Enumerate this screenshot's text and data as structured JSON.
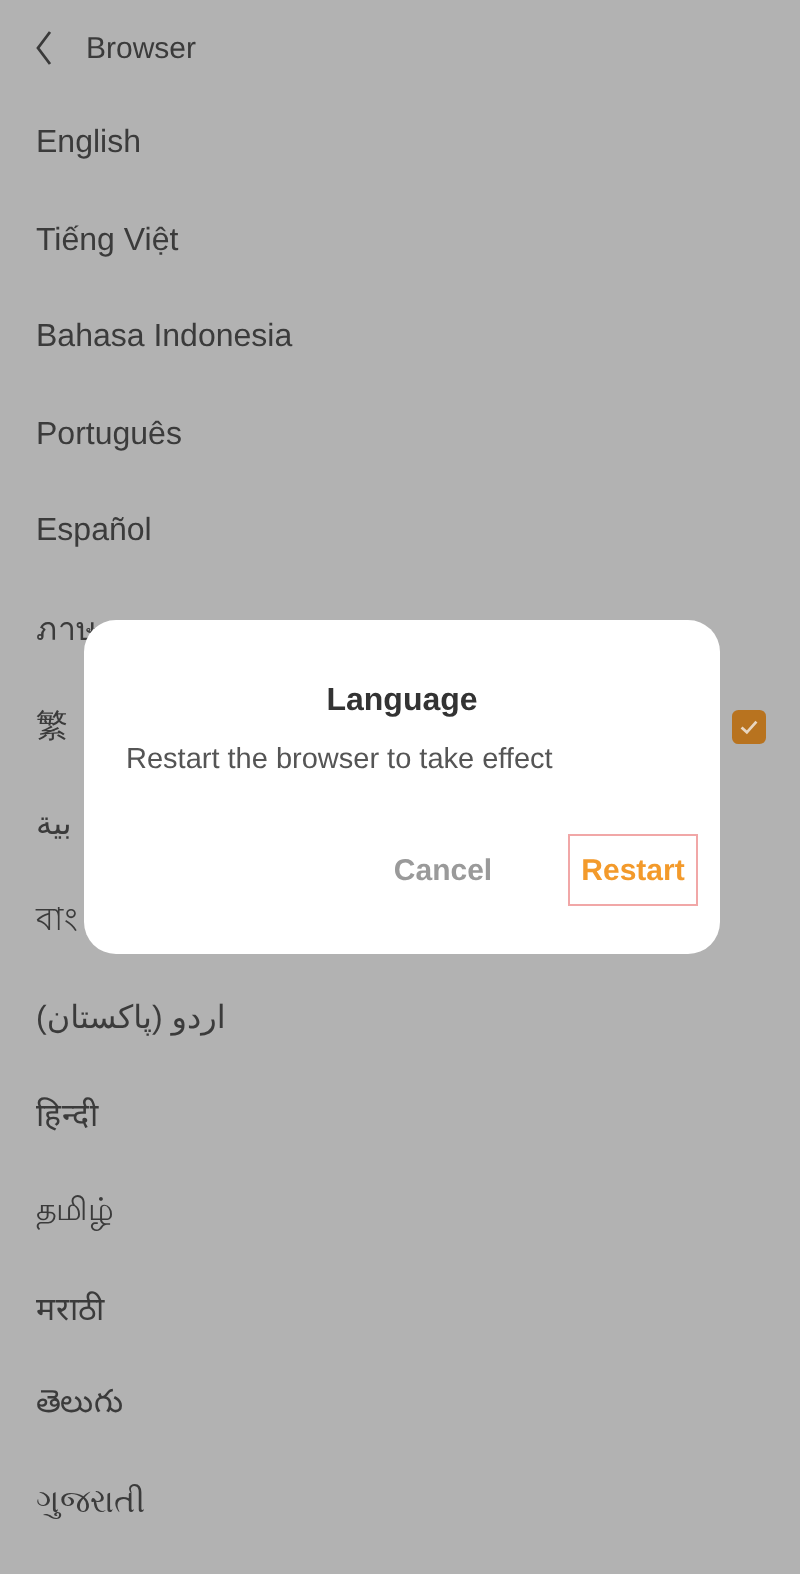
{
  "header": {
    "title": "Browser"
  },
  "languages": [
    {
      "label": "English",
      "selected": false
    },
    {
      "label": "Tiếng Việt",
      "selected": false
    },
    {
      "label": "Bahasa Indonesia",
      "selected": false
    },
    {
      "label": "Português",
      "selected": false
    },
    {
      "label": "Español",
      "selected": false
    },
    {
      "label": "ภาษ",
      "selected": false
    },
    {
      "label": "繁",
      "selected": true
    },
    {
      "label": "بية",
      "selected": false
    },
    {
      "label": "বাং",
      "selected": false
    },
    {
      "label": "اردو (پاکستان)",
      "selected": false
    },
    {
      "label": "हिन्दी",
      "selected": false
    },
    {
      "label": "தமிழ்",
      "selected": false
    },
    {
      "label": "मराठी",
      "selected": false
    },
    {
      "label": "తెలుగు",
      "selected": false
    },
    {
      "label": "ગુજરાતી",
      "selected": false
    }
  ],
  "dialog": {
    "title": "Language",
    "message": "Restart the browser to take effect",
    "buttons": [
      {
        "label": "Cancel",
        "kind": "secondary",
        "highlighted": false
      },
      {
        "label": "Restart",
        "kind": "primary",
        "highlighted": true
      }
    ]
  }
}
